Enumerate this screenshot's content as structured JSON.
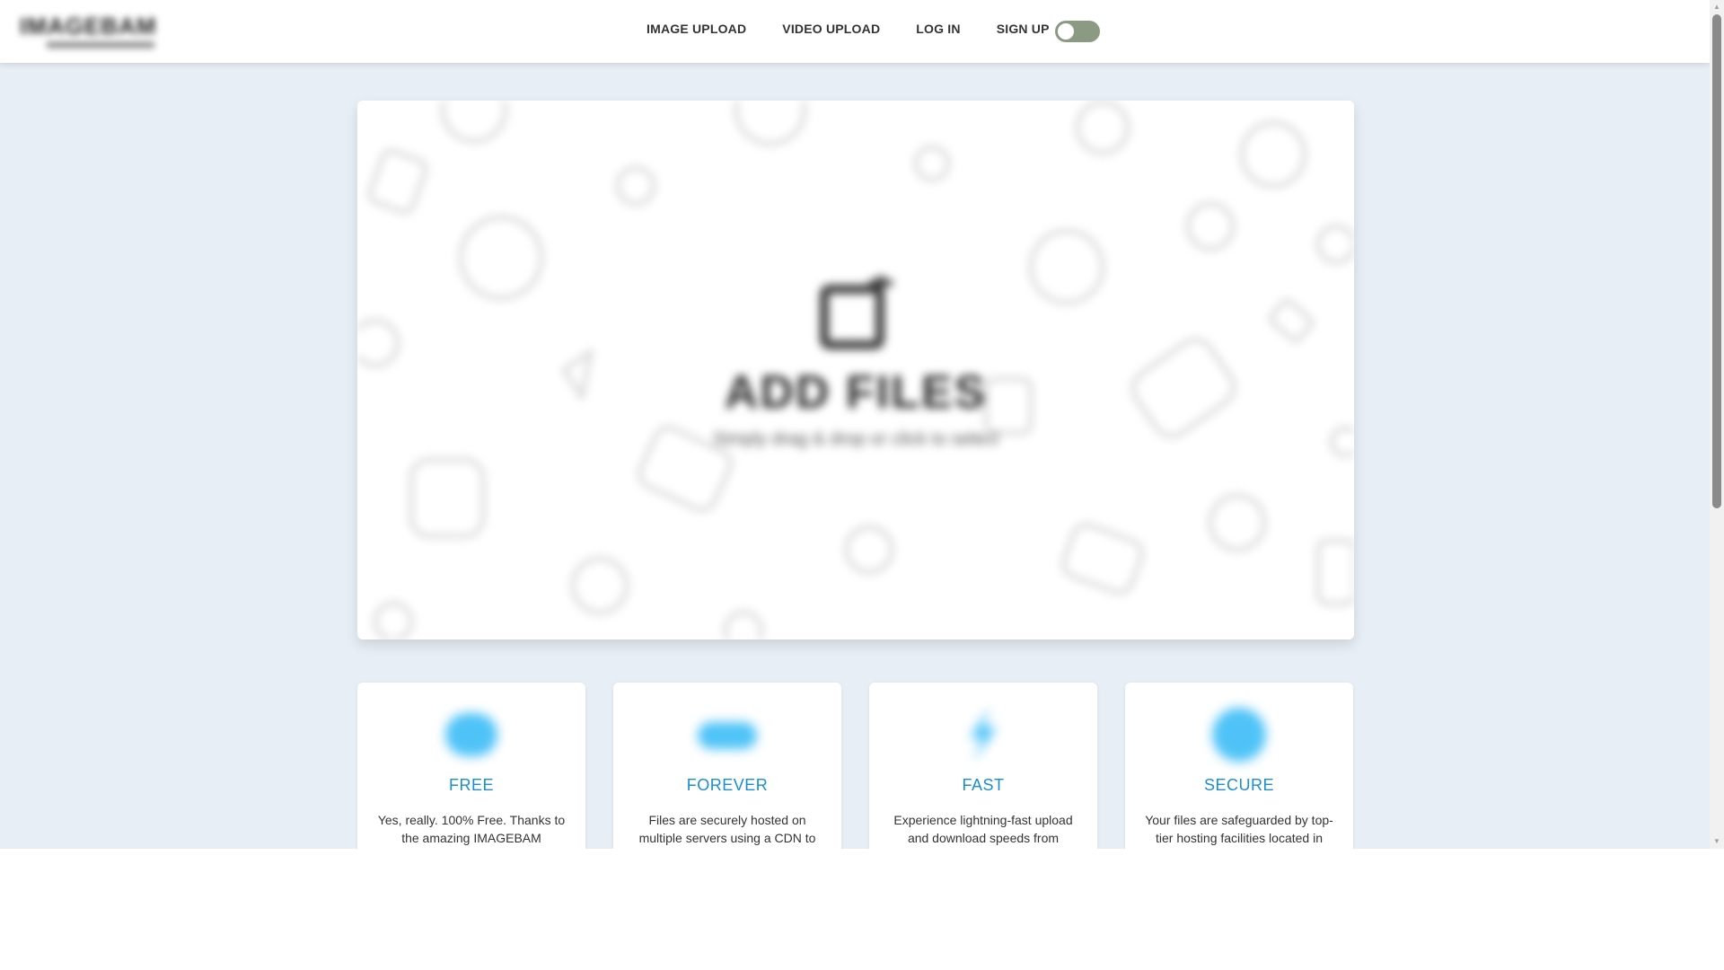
{
  "navbar": {
    "logo_text": "IMAGEBAM",
    "links": [
      "IMAGE UPLOAD",
      "VIDEO UPLOAD",
      "LOG IN",
      "SIGN UP"
    ],
    "theme_toggle_icon": "toggle-switch"
  },
  "upload": {
    "title": "ADD FILES",
    "subtitle": "Simply drag & drop or click to select",
    "icon": "upload-image-icon"
  },
  "features": [
    {
      "icon": "free-icon",
      "title": "FREE",
      "desc": "Yes, really. 100% Free. Thanks to the amazing IMAGEBAM"
    },
    {
      "icon": "cloud-icon",
      "title": "FOREVER",
      "desc": "Files are securely hosted on multiple servers using a CDN to"
    },
    {
      "icon": "lightning-icon",
      "title": "FAST",
      "desc": "Experience lightning-fast upload and download speeds from"
    },
    {
      "icon": "shield-icon",
      "title": "SECURE",
      "desc": "Your files are safeguarded by top-tier hosting facilities located in"
    }
  ],
  "colors": {
    "page_bg": "#e8eef6",
    "accent": "#1a8ed0",
    "toggle_track": "#8a9a83",
    "feature_icon": "#4fc3f7"
  }
}
